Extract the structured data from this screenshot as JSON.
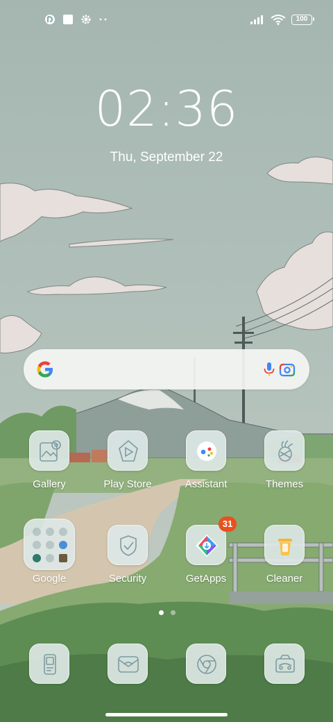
{
  "status_bar": {
    "battery": "100",
    "left_icons": [
      "notification-app-icon",
      "square-notification-icon",
      "settings-gear-icon",
      "more-dots-icon"
    ],
    "right_icons": [
      "signal-icon",
      "wifi-icon",
      "battery-icon"
    ]
  },
  "clock": {
    "time": "02:36",
    "date": "Thu, September 22"
  },
  "search": {
    "icons": [
      "google-g-icon",
      "microphone-icon",
      "google-lens-icon"
    ]
  },
  "apps_row1": [
    {
      "label": "Gallery"
    },
    {
      "label": "Play Store"
    },
    {
      "label": "Assistant"
    },
    {
      "label": "Themes"
    }
  ],
  "apps_row2": [
    {
      "label": "Google"
    },
    {
      "label": "Security"
    },
    {
      "label": "GetApps",
      "badge": "31"
    },
    {
      "label": "Cleaner"
    }
  ],
  "dock": {
    "icons": [
      "phone-icon",
      "messages-icon",
      "chrome-icon",
      "camera-icon"
    ]
  },
  "page_indicator": {
    "pages": 2,
    "active": 1
  }
}
